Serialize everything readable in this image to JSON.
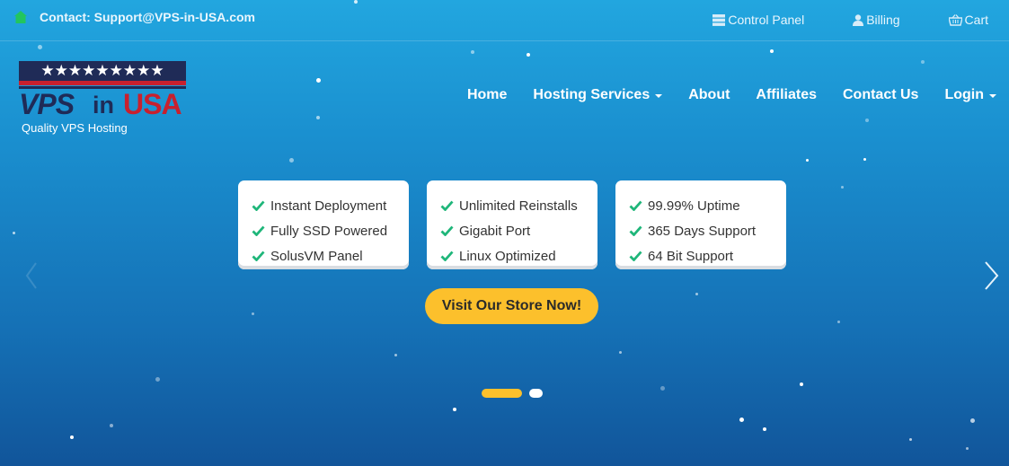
{
  "topbar": {
    "contact_text": "Contact: Support@VPS-in-USA.com",
    "links": [
      {
        "label": "Control Panel",
        "icon": "server-icon"
      },
      {
        "label": "Billing",
        "icon": "user-icon"
      },
      {
        "label": "Cart",
        "icon": "basket-icon"
      }
    ]
  },
  "logo": {
    "stars": "★★★★★★★★★",
    "word_vps": "VPS",
    "word_in": "in",
    "word_usa": "USA",
    "tagline": "Quality VPS Hosting"
  },
  "nav": {
    "items": [
      {
        "label": "Home"
      },
      {
        "label": "Hosting Services"
      },
      {
        "label": "About"
      },
      {
        "label": "Affiliates"
      },
      {
        "label": "Contact Us"
      },
      {
        "label": "Login"
      }
    ]
  },
  "features": [
    {
      "items": [
        "Instant Deployment",
        "Fully SSD Powered",
        "SolusVM Panel"
      ]
    },
    {
      "items": [
        "Unlimited Reinstalls",
        "Gigabit Port",
        "Linux Optimized"
      ]
    },
    {
      "items": [
        "99.99% Uptime",
        "365 Days Support",
        "64 Bit Support"
      ]
    }
  ],
  "cta": {
    "label": "Visit Our Store Now!"
  },
  "colors": {
    "accent": "#fcc02c",
    "check": "#1fb67a",
    "navy": "#1f2b57",
    "red": "#c8202e",
    "home_icon": "#22c55e"
  }
}
